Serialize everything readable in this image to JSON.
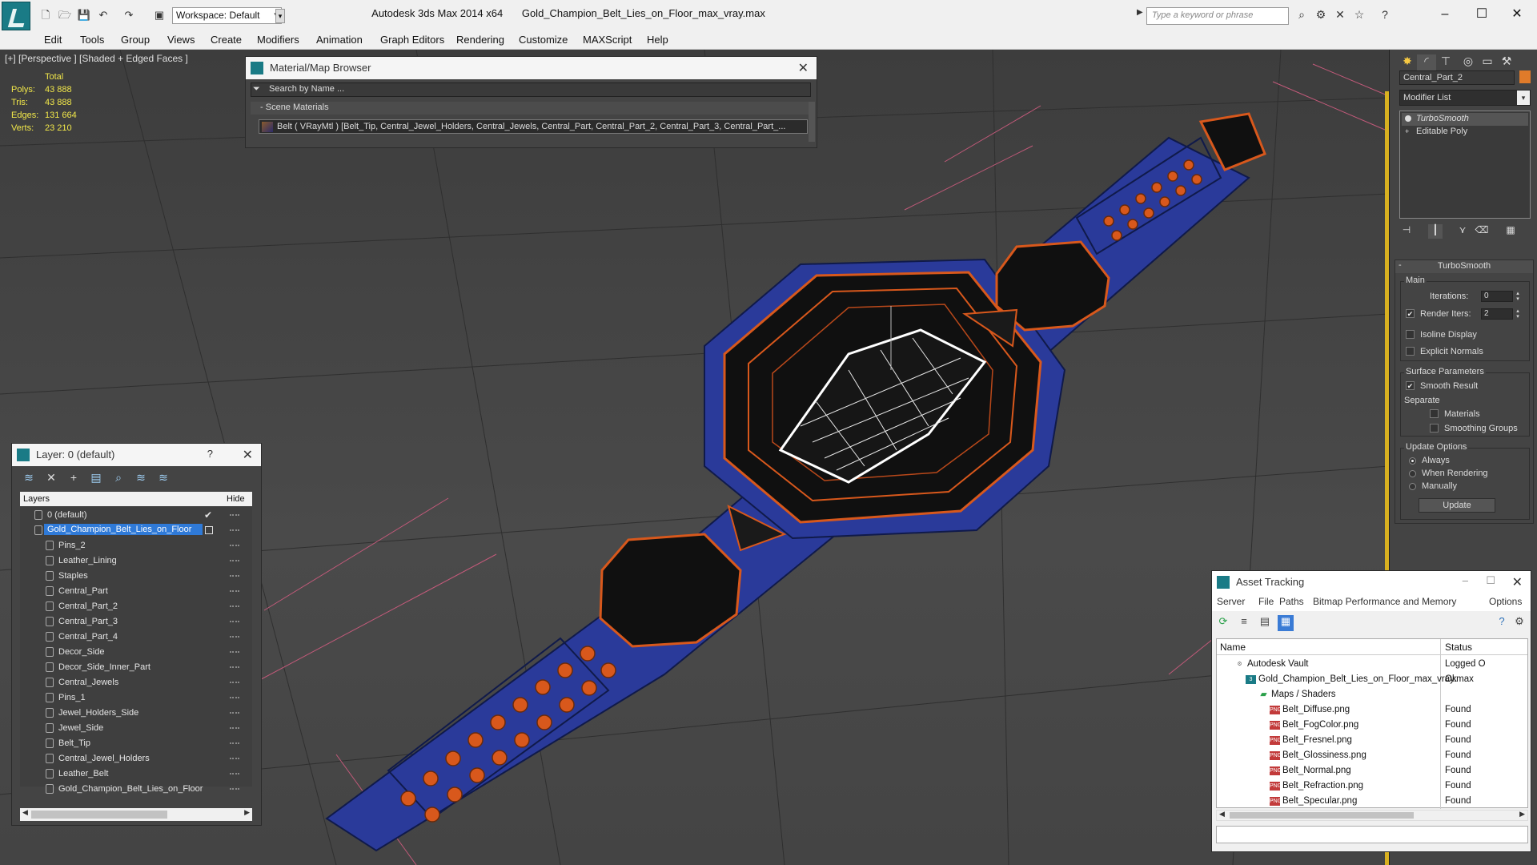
{
  "app": {
    "title": "Autodesk 3ds Max  2014 x64",
    "file": "Gold_Champion_Belt_Lies_on_Floor_max_vray.max",
    "workspace": "Workspace: Default",
    "search_placeholder": "Type a keyword or phrase"
  },
  "menu": [
    "Edit",
    "Tools",
    "Group",
    "Views",
    "Create",
    "Modifiers",
    "Animation",
    "Graph Editors",
    "Rendering",
    "Customize",
    "MAXScript",
    "Help"
  ],
  "viewport": {
    "label": "[+] [Perspective ] [Shaded + Edged Faces ]",
    "stats": {
      "header": "Total",
      "rows": [
        {
          "label": "Polys:",
          "value": "43 888"
        },
        {
          "label": "Tris:",
          "value": "43 888"
        },
        {
          "label": "Edges:",
          "value": "131 664"
        },
        {
          "label": "Verts:",
          "value": "23 210"
        }
      ]
    }
  },
  "material_browser": {
    "title": "Material/Map Browser",
    "search": "Search by Name ...",
    "section": "Scene Materials",
    "item": "Belt  ( VRayMtl )  [Belt_Tip, Central_Jewel_Holders, Central_Jewels, Central_Part, Central_Part_2, Central_Part_3, Central_Part_..."
  },
  "layers": {
    "title": "Layer: 0 (default)",
    "question": "?",
    "col_layers": "Layers",
    "col_hide": "Hide",
    "rows": [
      "0 (default)",
      "Gold_Champion_Belt_Lies_on_Floor",
      "Pins_2",
      "Leather_Lining",
      "Staples",
      "Central_Part",
      "Central_Part_2",
      "Central_Part_3",
      "Central_Part_4",
      "Decor_Side",
      "Decor_Side_Inner_Part",
      "Central_Jewels",
      "Pins_1",
      "Jewel_Holders_Side",
      "Jewel_Side",
      "Belt_Tip",
      "Central_Jewel_Holders",
      "Leather_Belt",
      "Gold_Champion_Belt_Lies_on_Floor"
    ]
  },
  "command_panel": {
    "object_name": "Central_Part_2",
    "object_color": "#e07b2a",
    "modifier_list": "Modifier List",
    "stack": [
      "TurboSmooth",
      "Editable Poly"
    ],
    "rollout_title": "TurboSmooth",
    "main_label": "Main",
    "iterations_label": "Iterations:",
    "iterations": "0",
    "render_iters_label": "Render Iters:",
    "render_iters": "2",
    "isoline": "Isoline Display",
    "explicit_normals": "Explicit Normals",
    "surface_params": "Surface Parameters",
    "smooth_result": "Smooth Result",
    "separate": "Separate",
    "materials": "Materials",
    "smoothing_groups": "Smoothing Groups",
    "update_options": "Update Options",
    "always": "Always",
    "when_rendering": "When Rendering",
    "manually": "Manually",
    "update_btn": "Update"
  },
  "asset_tracking": {
    "title": "Asset Tracking",
    "menu": [
      "Server",
      "File",
      "Paths",
      "Bitmap Performance and Memory",
      "Options"
    ],
    "col_name": "Name",
    "col_status": "Status",
    "rows": [
      {
        "name": "Autodesk Vault",
        "status": "Logged O",
        "indent": 0,
        "icon": "vault-icon"
      },
      {
        "name": "Gold_Champion_Belt_Lies_on_Floor_max_vray.max",
        "status": "Ok",
        "indent": 1,
        "icon": "max-file-icon"
      },
      {
        "name": "Maps / Shaders",
        "status": "",
        "indent": 2,
        "icon": "maps-icon"
      },
      {
        "name": "Belt_Diffuse.png",
        "status": "Found",
        "indent": 3,
        "icon": "png-icon"
      },
      {
        "name": "Belt_FogColor.png",
        "status": "Found",
        "indent": 3,
        "icon": "png-icon"
      },
      {
        "name": "Belt_Fresnel.png",
        "status": "Found",
        "indent": 3,
        "icon": "png-icon"
      },
      {
        "name": "Belt_Glossiness.png",
        "status": "Found",
        "indent": 3,
        "icon": "png-icon"
      },
      {
        "name": "Belt_Normal.png",
        "status": "Found",
        "indent": 3,
        "icon": "png-icon"
      },
      {
        "name": "Belt_Refraction.png",
        "status": "Found",
        "indent": 3,
        "icon": "png-icon"
      },
      {
        "name": "Belt_Specular.png",
        "status": "Found",
        "indent": 3,
        "icon": "png-icon"
      }
    ]
  },
  "colors": {
    "belt_blue": "#2a3a9a",
    "wire_orange": "#d8581c",
    "stats_yellow": "#f2e84a",
    "selection_blue": "#2f7ad8"
  }
}
